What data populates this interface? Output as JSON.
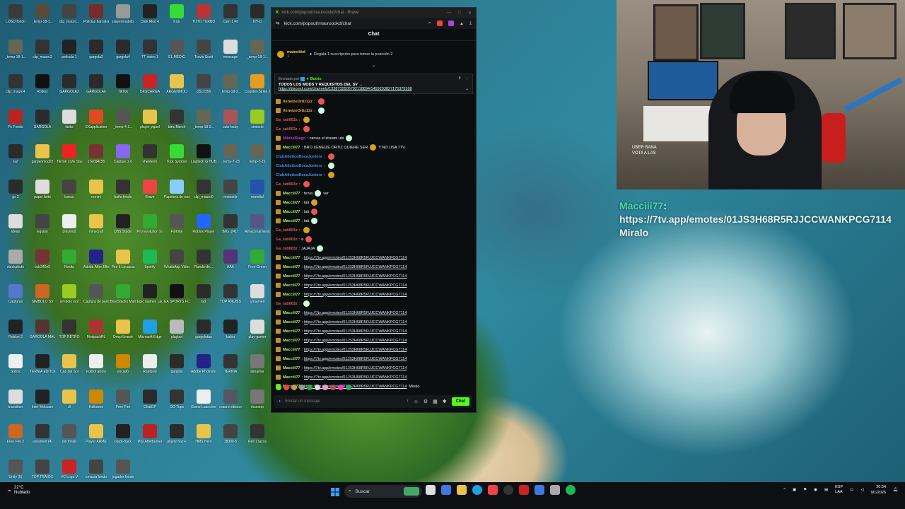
{
  "desktop": {
    "icons": [
      {
        "label": "LOSO fondo",
        "color": "#3a3a3a"
      },
      {
        "label": "_temp-18-1...",
        "color": "#5a4a3a"
      },
      {
        "label": "clip_mauro...",
        "color": "#444"
      },
      {
        "label": "Policias barcelona",
        "color": "#7a2a2a"
      },
      {
        "label": "playermodelb",
        "color": "#999"
      },
      {
        "label": "Dark Mod 4",
        "color": "#222"
      },
      {
        "label": "Kick",
        "color": "#3d3"
      },
      {
        "label": "TOTO TURBO",
        "color": "#b33"
      },
      {
        "label": "Cam 1 Fit",
        "color": "#333"
      },
      {
        "label": "NY-lo",
        "color": "#2a2a2a"
      },
      {
        "label": "_temp-18-1...",
        "color": "#665"
      },
      {
        "label": "clip_mauro2",
        "color": "#333"
      },
      {
        "label": "pelicula 1",
        "color": "#222"
      },
      {
        "label": "gargola2",
        "color": "#2b2b2b"
      },
      {
        "label": "gargola4",
        "color": "#2b2b2b"
      },
      {
        "label": "TT video 1",
        "color": "#333"
      },
      {
        "label": "EL MEDIC",
        "color": "#555"
      },
      {
        "label": "Travis Scott",
        "color": "#444"
      },
      {
        "label": "message",
        "color": "#ddd"
      },
      {
        "label": "_temp-18-1...",
        "color": "#665"
      },
      {
        "label": "clip_mauro4",
        "color": "#333"
      },
      {
        "label": "Roblox",
        "color": "#111"
      },
      {
        "label": "GARGOLA3",
        "color": "#2b2b2b"
      },
      {
        "label": "GARGOLA6",
        "color": "#2b2b2b"
      },
      {
        "label": "TikTok",
        "color": "#111"
      },
      {
        "label": "DESCARGA",
        "color": "#c22"
      },
      {
        "label": "ARGENMOD",
        "color": "#e8c44a"
      },
      {
        "label": "ct512356",
        "color": "#444"
      },
      {
        "label": "_temp-18-2...",
        "color": "#665"
      },
      {
        "label": "Counter-Strike 2",
        "color": "#e89b22"
      },
      {
        "label": "Pc Fondo",
        "color": "#b22"
      },
      {
        "label": "GARGOLA",
        "color": "#2b2b2b"
      },
      {
        "label": "kicks",
        "color": "#ddd"
      },
      {
        "label": "EXapplication",
        "color": "#e04a22"
      },
      {
        "label": "_temp-4-1...",
        "color": "#555"
      },
      {
        "label": "player yiguel",
        "color": "#e8c44a"
      },
      {
        "label": "btnc Merch",
        "color": "#333"
      },
      {
        "label": "_temp-18-2...",
        "color": "#665"
      },
      {
        "label": "cute-baby",
        "color": "#a55"
      },
      {
        "label": "simbolo",
        "color": "#9c2"
      },
      {
        "label": "G2",
        "color": "#2b2b2b"
      },
      {
        "label": "gargenmod22",
        "color": "#e8c44a"
      },
      {
        "label": "TikTok LIVE Studio",
        "color": "#e22"
      },
      {
        "label": "17e094c55",
        "color": "#733"
      },
      {
        "label": "Capture 2.0",
        "color": "#86e"
      },
      {
        "label": "vheeterm",
        "color": "#333"
      },
      {
        "label": "Kick Symbol",
        "color": "#3d3"
      },
      {
        "label": "Logitech G HUB",
        "color": "#111"
      },
      {
        "label": "_temp-7-23",
        "color": "#665"
      },
      {
        "label": "temp-7-23",
        "color": "#665"
      },
      {
        "label": "gs 2",
        "color": "#2b2b2b"
      },
      {
        "label": "papel lisito",
        "color": "#ddd"
      },
      {
        "label": "banco",
        "color": "#444"
      },
      {
        "label": "remini",
        "color": "#e8c44a"
      },
      {
        "label": "baña fondo",
        "color": "#333"
      },
      {
        "label": "Brave",
        "color": "#e44"
      },
      {
        "label": "Papelera de reciclaje",
        "color": "#8cf"
      },
      {
        "label": "clip_mauro0",
        "color": "#333"
      },
      {
        "label": "motosolr",
        "color": "#444"
      },
      {
        "label": "mundial",
        "color": "#25a"
      },
      {
        "label": "ideas",
        "color": "#ddd"
      },
      {
        "label": "Equipo",
        "color": "#444"
      },
      {
        "label": "playmod",
        "color": "#eee"
      },
      {
        "label": "minecraft",
        "color": "#e8c44a"
      },
      {
        "label": "OBS Studio",
        "color": "#222"
      },
      {
        "label": "Pro Evolution Soccer 6",
        "color": "#3a3"
      },
      {
        "label": "Fortnite",
        "color": "#555"
      },
      {
        "label": "Roblox Player",
        "color": "#26f"
      },
      {
        "label": "IMG_2417",
        "color": "#333"
      },
      {
        "label": "Almacenamiento",
        "color": "#558"
      },
      {
        "label": "stockphoto",
        "color": "#aaa"
      },
      {
        "label": "bcb242e5",
        "color": "#733"
      },
      {
        "label": "Nvidia",
        "color": "#3a3"
      },
      {
        "label": "Adobe After Effects",
        "color": "#228"
      },
      {
        "label": "Pes 6 Locazos",
        "color": "#e8c44a"
      },
      {
        "label": "Spotify",
        "color": "#1db954"
      },
      {
        "label": "WhatsApp Video 2025",
        "color": "#444"
      },
      {
        "label": "Ruedo-de...",
        "color": "#333"
      },
      {
        "label": "AAA",
        "color": "#537"
      },
      {
        "label": "Free-Green",
        "color": "#3a3"
      },
      {
        "label": "Capturas",
        "color": "#57c"
      },
      {
        "label": "SIMBOLO SV",
        "color": "#c62"
      },
      {
        "label": "simbolo sv2",
        "color": "#9c2"
      },
      {
        "label": "Captura de pantalla",
        "color": "#555"
      },
      {
        "label": "BlueStacks Multi",
        "color": "#3a3"
      },
      {
        "label": "Epic Games Launcher",
        "color": "#222"
      },
      {
        "label": "EA SPORTS FC 26",
        "color": "#111"
      },
      {
        "label": "G3",
        "color": "#2b2b2b"
      },
      {
        "label": "TOP ANUBIS",
        "color": "#333"
      },
      {
        "label": "unnamed",
        "color": "#ddd"
      },
      {
        "label": "Roblox 2",
        "color": "#222"
      },
      {
        "label": "GARGOLA MAURO",
        "color": "#533"
      },
      {
        "label": "TOP RETRO",
        "color": "#333"
      },
      {
        "label": "ModpackRL",
        "color": "#a33"
      },
      {
        "label": "Deep Livestr",
        "color": "#e8c44a"
      },
      {
        "label": "Microsoft Edge",
        "color": "#1fa0e0"
      },
      {
        "label": "playbot",
        "color": "#bbb"
      },
      {
        "label": "gargoletaa",
        "color": "#2b2b2b"
      },
      {
        "label": "balón",
        "color": "#222"
      },
      {
        "label": "play-gamer",
        "color": "#ddd"
      },
      {
        "label": "textos",
        "color": "#eee"
      },
      {
        "label": "TERNIA EDITOR",
        "color": "#222"
      },
      {
        "label": "Cap del Sol",
        "color": "#e8c44a"
      },
      {
        "label": "Futbol arrow",
        "color": "#eee"
      },
      {
        "label": "escudo",
        "color": "#c80"
      },
      {
        "label": "Rainbow",
        "color": "#eee"
      },
      {
        "label": "gargola",
        "color": "#2b2b2b"
      },
      {
        "label": "Adobe Photoshop",
        "color": "#228"
      },
      {
        "label": "TERNIA",
        "color": "#333"
      },
      {
        "label": "streamer",
        "color": "#777"
      },
      {
        "label": "transition",
        "color": "#ddd"
      },
      {
        "label": "Intel Webcam",
        "color": "#222"
      },
      {
        "label": "dl",
        "color": "#e8c44a"
      },
      {
        "label": "Hallowen",
        "color": "#c80"
      },
      {
        "label": "Free Fire",
        "color": "#555"
      },
      {
        "label": "ChatGP",
        "color": "#2b2b2b"
      },
      {
        "label": "OG-Tops",
        "color": "#333"
      },
      {
        "label": "Game Launcher",
        "color": "#eee"
      },
      {
        "label": "mauro edicion",
        "color": "#556"
      },
      {
        "label": "ricoomp",
        "color": "#777"
      },
      {
        "label": "Free Fire 2",
        "color": "#c62"
      },
      {
        "label": "unnamed (4)",
        "color": "#333"
      },
      {
        "label": "old fondo",
        "color": "#555"
      },
      {
        "label": "Player ARME",
        "color": "#e8c44a"
      },
      {
        "label": "black-back",
        "color": "#222"
      },
      {
        "label": "MSI Afterburner",
        "color": "#b22"
      },
      {
        "label": "player hac-k",
        "color": "#2b2b2b"
      },
      {
        "label": "HMS Hero",
        "color": "#e8c44a"
      },
      {
        "label": "18390-5",
        "color": "#444"
      },
      {
        "label": "Rell 1 tacos",
        "color": "#333"
      },
      {
        "label": "Unity (5)",
        "color": "#555"
      },
      {
        "label": "TOP TRAIOC",
        "color": "#444"
      },
      {
        "label": "VC Logo V",
        "color": "#c22"
      },
      {
        "label": "emacia fondo",
        "color": "#444"
      },
      {
        "label": "jugador fondo",
        "color": "#555"
      }
    ]
  },
  "browser": {
    "title": "kick.com/popout/mauroookd/chat - Brave",
    "url": "kick.com/popout/mauroookd/chat"
  },
  "chat": {
    "header": "Chat",
    "top_gifter": {
      "name": "mateokkd",
      "count": "1",
      "text": "Regala 1 suscripción para tomar la posición 2"
    },
    "pinned": {
      "sender_prefix": "Enviado por",
      "sender": "Botrix",
      "title": "TODOS LOS MODS Y REQUISITOS DEL SV →",
      "link": "https://discord.com/channels/1338732505792118894/1459203827175379108"
    },
    "messages": [
      {
        "user": "XeneizeOrtiz12z",
        "color": "#f7a547",
        "text": "",
        "badge": true
      },
      {
        "user": "XeneizeOrtiz12z",
        "color": "#f7a547",
        "text": "",
        "badge": true
      },
      {
        "user": "Gs_tati003z",
        "color": "#e05a5a",
        "text": "",
        "badge": false
      },
      {
        "user": "Gs_tati003z",
        "color": "#e05a5a",
        "text": "",
        "badge": false
      },
      {
        "user": "NiloheDiego",
        "color": "#c63ad8",
        "text": "carrea el stream ubi",
        "badge": true
      },
      {
        "user": "Macciii77",
        "color": "#a6f26a",
        "text": "BRO XENEIZE ORTIZ QUIERE SER",
        "badge": true,
        "tail": "Y NO USA 7TV"
      },
      {
        "user": "ClubAtleticoBocaJuniors",
        "color": "#3c8ef0",
        "text": "",
        "badge": false
      },
      {
        "user": "ClubAtleticoBocaJuniors",
        "color": "#3c8ef0",
        "text": "",
        "badge": false
      },
      {
        "user": "ClubAtleticoBocaJuniors",
        "color": "#3c8ef0",
        "text": "",
        "badge": false
      },
      {
        "user": "Gs_tati003z",
        "color": "#e05a5a",
        "text": "",
        "badge": false
      },
      {
        "user": "Macciii77",
        "color": "#a6f26a",
        "text": "tenía",
        "badge": true,
        "tail": "ver"
      },
      {
        "user": "Macciii77",
        "color": "#a6f26a",
        "text": "tati",
        "badge": true
      },
      {
        "user": "Macciii77",
        "color": "#a6f26a",
        "text": "tati",
        "badge": true
      },
      {
        "user": "Macciii77",
        "color": "#a6f26a",
        "text": "tati",
        "badge": true
      },
      {
        "user": "Gs_tati003z",
        "color": "#e05a5a",
        "text": "",
        "badge": false
      },
      {
        "user": "Gs_tati003z",
        "color": "#e05a5a",
        "text": "a",
        "badge": false
      },
      {
        "user": "Gs_tati003z",
        "color": "#e05a5a",
        "text": "JAJAJA",
        "badge": false
      },
      {
        "user": "Macciii77",
        "color": "#a6f26a",
        "link": "https://7tv.app/emotes/01JS3H68R5RJJCCWANKPCG7114",
        "badge": true
      },
      {
        "user": "Macciii77",
        "color": "#a6f26a",
        "link": "https://7tv.app/emotes/01JS3H68R5RJJCCWANKPCG7114",
        "badge": true
      },
      {
        "user": "Macciii77",
        "color": "#a6f26a",
        "link": "https://7tv.app/emotes/01JS3H68R5RJJCCWANKPCG7114",
        "badge": true
      },
      {
        "user": "Macciii77",
        "color": "#a6f26a",
        "link": "https://7tv.app/emotes/01JS3H68R5RJJCCWANKPCG7114",
        "badge": true
      },
      {
        "user": "Macciii77",
        "color": "#a6f26a",
        "link": "https://7tv.app/emotes/01JS3H68R5RJJCCWANKPCG7114",
        "badge": true
      },
      {
        "user": "Gs_tati003z",
        "color": "#e05a5a",
        "text": "",
        "badge": false
      },
      {
        "user": "Macciii77",
        "color": "#a6f26a",
        "link": "https://7tv.app/emotes/01JS3H68R5RJJCCWANKPCG7114",
        "badge": true
      },
      {
        "user": "Macciii77",
        "color": "#a6f26a",
        "link": "https://7tv.app/emotes/01JS3H68R5RJJCCWANKPCG7114",
        "badge": true
      },
      {
        "user": "Macciii77",
        "color": "#a6f26a",
        "link": "https://7tv.app/emotes/01JS3H68R5RJJCCWANKPCG7114",
        "badge": true
      },
      {
        "user": "Macciii77",
        "color": "#a6f26a",
        "link": "https://7tv.app/emotes/01JS3H68R5RJJCCWANKPCG7114",
        "badge": true
      },
      {
        "user": "Macciii77",
        "color": "#a6f26a",
        "link": "https://7tv.app/emotes/01JS3H68R5RJJCCWANKPCG7114",
        "badge": true
      },
      {
        "user": "Macciii77",
        "color": "#a6f26a",
        "link": "https://7tv.app/emotes/01JS3H68R5RJJCCWANKPCG7114",
        "badge": true
      },
      {
        "user": "Macciii77",
        "color": "#a6f26a",
        "link": "https://7tv.app/emotes/01JS3H68R5RJJCCWANKPCG7114",
        "badge": true
      },
      {
        "user": "Macciii77",
        "color": "#a6f26a",
        "link": "https://7tv.app/emotes/01JS3H68R5RJJCCWANKPCG7114",
        "badge": true
      },
      {
        "user": "Macciii77",
        "color": "#a6f26a",
        "link": "https://7tv.app/emotes/01JS3H68R5RJJCCWANKPCG7114",
        "badge": true,
        "tail": "Miralo"
      }
    ],
    "input_placeholder": "Enviar un mensaje",
    "send_label": "Chat"
  },
  "webcam": {
    "overlay_lines": [
      "UBER BANA",
      "VOTA A LAS"
    ]
  },
  "stream_overlay": {
    "user": "Macciii77",
    "text": "https://7tv.app/emotes/01JS3H68R5RJJCCWANKPCG7114 Miralo"
  },
  "taskbar": {
    "weather_temp": "22°C",
    "weather_desc": "Nublado",
    "search_label": "Buscar",
    "lang_top": "ESP",
    "lang_bottom": "LAA",
    "time": "20:54",
    "date": "9/1/2026"
  }
}
